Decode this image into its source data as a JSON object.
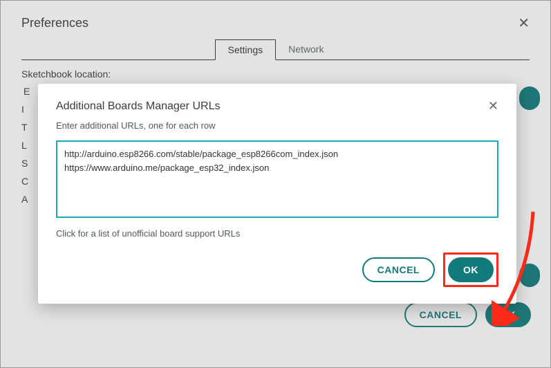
{
  "prefs": {
    "title": "Preferences",
    "tabs": {
      "settings": "Settings",
      "network": "Network"
    },
    "sketchbook_label": "Sketchbook location:",
    "partial_letters": [
      "E",
      "I",
      "T",
      "L",
      "S",
      "C",
      "A"
    ],
    "cancel": "CANCEL",
    "ok": "OK"
  },
  "modal": {
    "title": "Additional Boards Manager URLs",
    "subtitle": "Enter additional URLs, one for each row",
    "urls": "http://arduino.esp8266.com/stable/package_esp8266com_index.json\nhttps://www.arduino.me/package_esp32_index.json",
    "hint": "Click for a list of unofficial board support URLs",
    "cancel": "CANCEL",
    "ok": "OK"
  }
}
